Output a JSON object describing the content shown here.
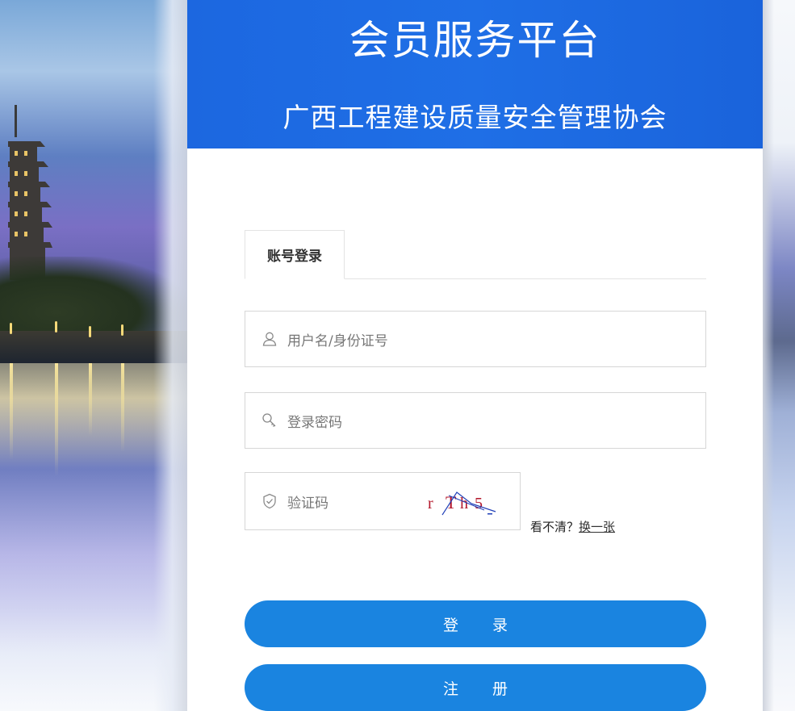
{
  "banner": {
    "title": "会员服务平台",
    "subtitle": "广西工程建设质量安全管理协会",
    "color": "#1c67e0"
  },
  "tabs": [
    {
      "label": "账号登录",
      "active": true
    }
  ],
  "form": {
    "username": {
      "placeholder": "用户名/身份证号",
      "value": "",
      "icon": "user-icon"
    },
    "password": {
      "placeholder": "登录密码",
      "value": "",
      "icon": "key-icon"
    },
    "captcha": {
      "placeholder": "验证码",
      "value": "",
      "icon": "shield-check-icon",
      "image_text": "r T h 5",
      "hint": "看不清？",
      "refresh_label": "换一张"
    }
  },
  "buttons": {
    "login_label": "登 录",
    "register_label": "注 册",
    "color": "#1a84e0"
  }
}
